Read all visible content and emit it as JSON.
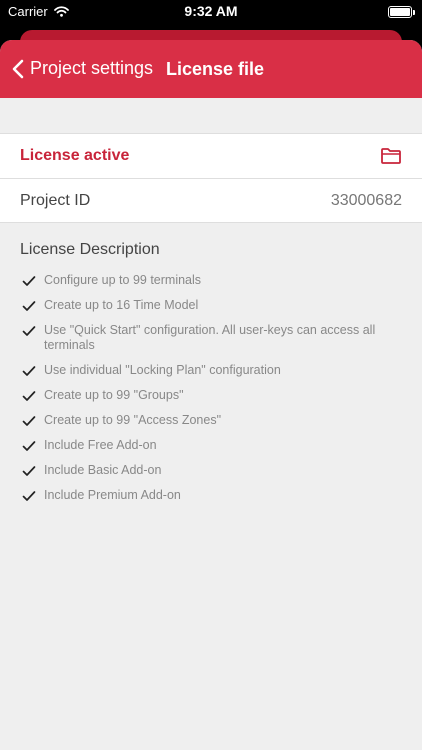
{
  "status_bar": {
    "carrier": "Carrier",
    "time": "9:32 AM",
    "battery_level": 1.0
  },
  "nav": {
    "back_label": "Project settings",
    "title": "License file"
  },
  "license": {
    "status": "License active",
    "project_id_label": "Project ID",
    "project_id_value": "33000682"
  },
  "description": {
    "title": "License Description",
    "features": [
      "Configure up to 99 terminals",
      "Create up to 16 Time Model",
      "Use \"Quick Start\" configuration. All user-keys can access all terminals",
      "Use individual \"Locking Plan\" configuration",
      "Create up to 99 \"Groups\"",
      "Create up to 99 \"Access Zones\"",
      "Include Free Add-on",
      "Include Basic Add-on",
      "Include Premium Add-on"
    ]
  },
  "colors": {
    "accent": "#d92f46",
    "accent_text": "#c8243a",
    "background": "#efefef"
  },
  "icons": {
    "folder": "folder-icon",
    "back": "chevron-left-icon",
    "check": "checkmark-icon"
  }
}
